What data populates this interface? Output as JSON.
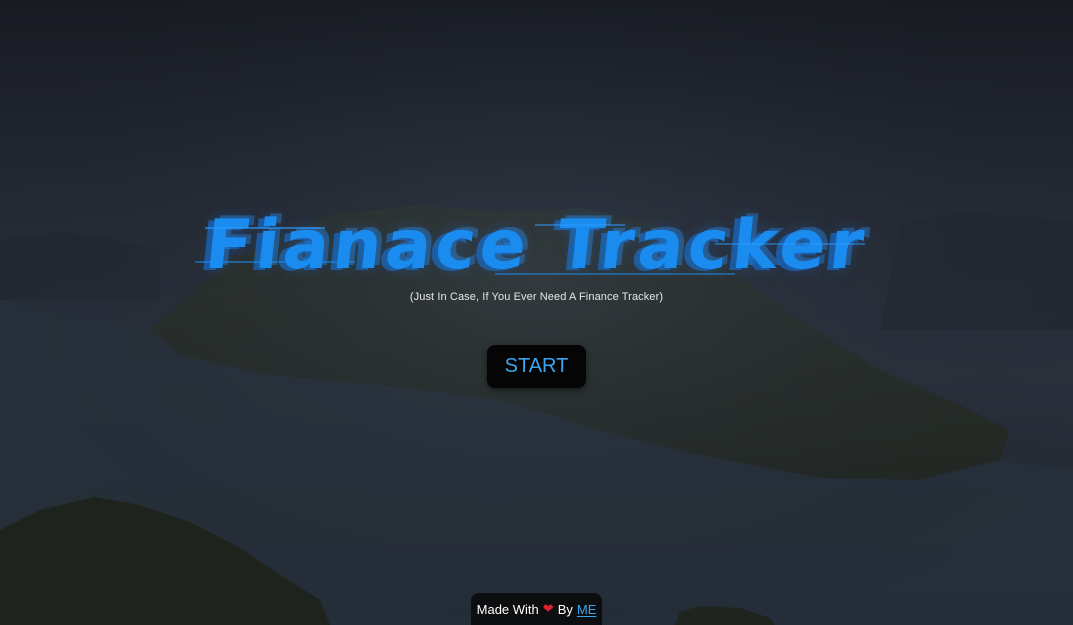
{
  "hero": {
    "title": "Fianace Tracker",
    "subtitle": "(Just In Case, If You Ever Need A Finance Tracker)",
    "start_label": "START"
  },
  "footer": {
    "made_with": "Made With",
    "heart_icon": "heart-icon",
    "by": "By",
    "link_label": "ME"
  },
  "colors": {
    "title": "#1a8cf0",
    "accent": "#3aa6ee",
    "heart": "#e0212b",
    "button_bg": "#050505"
  }
}
